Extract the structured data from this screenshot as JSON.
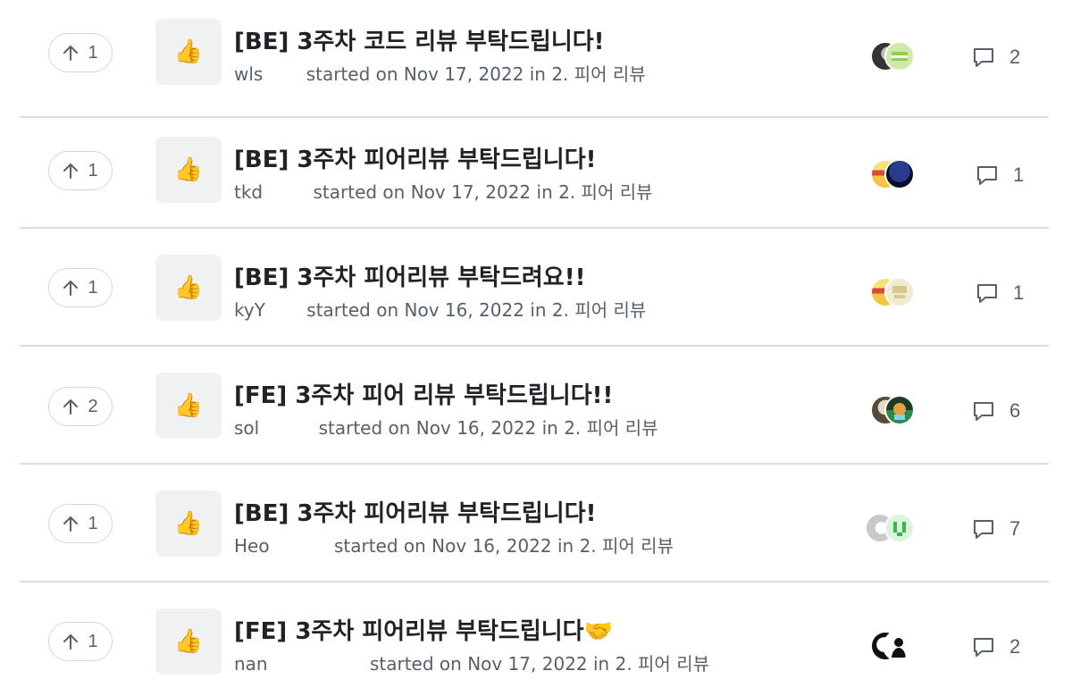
{
  "discussions": [
    {
      "upvotes": "1",
      "emoji": "👍",
      "title": "[BE] 3주차 코드 리뷰 부탁드립니다!",
      "author": "wls",
      "started_label": "started on",
      "date": "Nov 17, 2022",
      "in_label": "in",
      "category": "2. 피어 리뷰",
      "comments": "2"
    },
    {
      "upvotes": "1",
      "emoji": "👍",
      "title": "[BE] 3주차 피어리뷰 부탁드립니다!",
      "author": "tkd",
      "started_label": "started on",
      "date": "Nov 17, 2022",
      "in_label": "in",
      "category": "2. 피어 리뷰",
      "comments": "1"
    },
    {
      "upvotes": "1",
      "emoji": "👍",
      "title": "[BE] 3주차 피어리뷰 부탁드려요!!",
      "author": "kyY",
      "started_label": "started on",
      "date": "Nov 16, 2022",
      "in_label": "in",
      "category": "2. 피어 리뷰",
      "comments": "1"
    },
    {
      "upvotes": "2",
      "emoji": "👍",
      "title": "[FE] 3주차 피어 리뷰 부탁드립니다!!",
      "author": "sol",
      "started_label": "started on",
      "date": "Nov 16, 2022",
      "in_label": "in",
      "category": "2. 피어 리뷰",
      "comments": "6"
    },
    {
      "upvotes": "1",
      "emoji": "👍",
      "title": "[BE] 3주차 피어리뷰 부탁드립니다!",
      "author": "Heo",
      "started_label": "started on",
      "date": "Nov 16, 2022",
      "in_label": "in",
      "category": "2. 피어 리뷰",
      "comments": "7"
    },
    {
      "upvotes": "1",
      "emoji": "👍",
      "title": "[FE] 3주차 피어리뷰 부탁드립니다🤝",
      "author": "nan",
      "started_label": "started on",
      "date": "Nov 17, 2022",
      "in_label": "in",
      "category": "2. 피어 리뷰",
      "comments": "2"
    }
  ],
  "colors": {
    "divider": "#d8dee4",
    "muted_text": "#57606a",
    "emoji_box_bg": "#eff1f3"
  }
}
